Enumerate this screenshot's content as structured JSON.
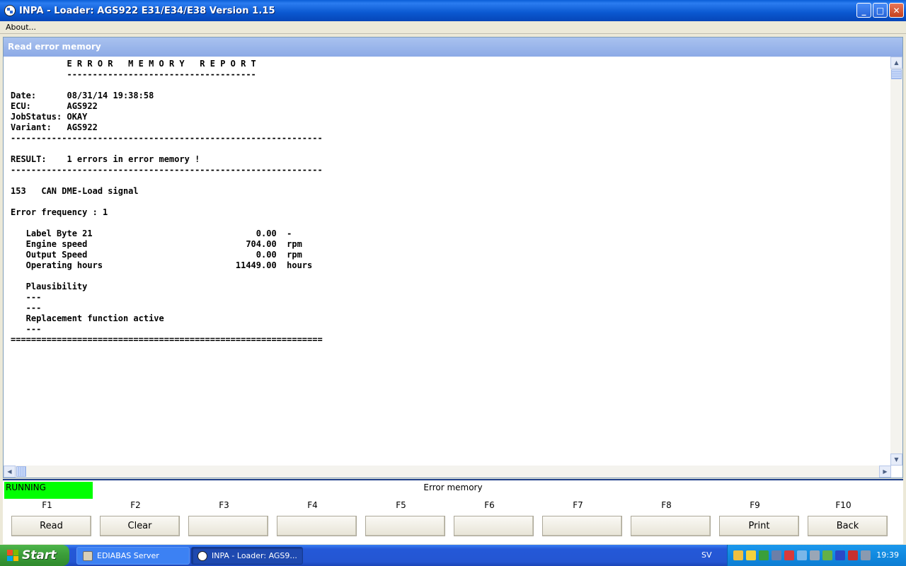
{
  "window": {
    "title": "INPA - Loader:  AGS922 E31/E34/E38 Version 1.15",
    "minimize": "_",
    "maximize": "□",
    "close": "✕"
  },
  "menu": {
    "about": "About..."
  },
  "panel": {
    "title": "Read error memory"
  },
  "report": {
    "lines": [
      "           E R R O R   M E M O R Y   R E P O R T",
      "           -------------------------------------",
      "",
      "Date:      08/31/14 19:38:58",
      "ECU:       AGS922",
      "JobStatus: OKAY",
      "Variant:   AGS922",
      "-------------------------------------------------------------",
      "",
      "RESULT:    1 errors in error memory !",
      "-------------------------------------------------------------",
      "",
      "153   CAN DME-Load signal",
      "",
      "Error frequency : 1",
      "",
      "   Label Byte 21                                0.00  -",
      "   Engine speed                               704.00  rpm",
      "   Output Speed                                 0.00  rpm",
      "   Operating hours                          11449.00  hours",
      "",
      "   Plausibility",
      "   ---",
      "   ---",
      "   Replacement function active",
      "   ---",
      "============================================================="
    ]
  },
  "status": {
    "state": "RUNNING",
    "state_color": "#00ff00",
    "screen_title": "Error memory"
  },
  "function_keys": [
    {
      "key": "F1",
      "label": "Read"
    },
    {
      "key": "F2",
      "label": "Clear"
    },
    {
      "key": "F3",
      "label": ""
    },
    {
      "key": "F4",
      "label": ""
    },
    {
      "key": "F5",
      "label": ""
    },
    {
      "key": "F6",
      "label": ""
    },
    {
      "key": "F7",
      "label": ""
    },
    {
      "key": "F8",
      "label": ""
    },
    {
      "key": "F9",
      "label": "Print"
    },
    {
      "key": "F10",
      "label": "Back"
    }
  ],
  "taskbar": {
    "start": "Start",
    "tasks": [
      {
        "label": "EDIABAS Server",
        "icon": "ediabas-icon"
      },
      {
        "label": "INPA - Loader:  AGS9...",
        "icon": "bmw-icon"
      }
    ],
    "language": "SV",
    "clock": "19:39"
  },
  "colors": {
    "titlebar": "#0a58d0",
    "running_status": "#00ff00",
    "taskbar": "#2456d2"
  }
}
